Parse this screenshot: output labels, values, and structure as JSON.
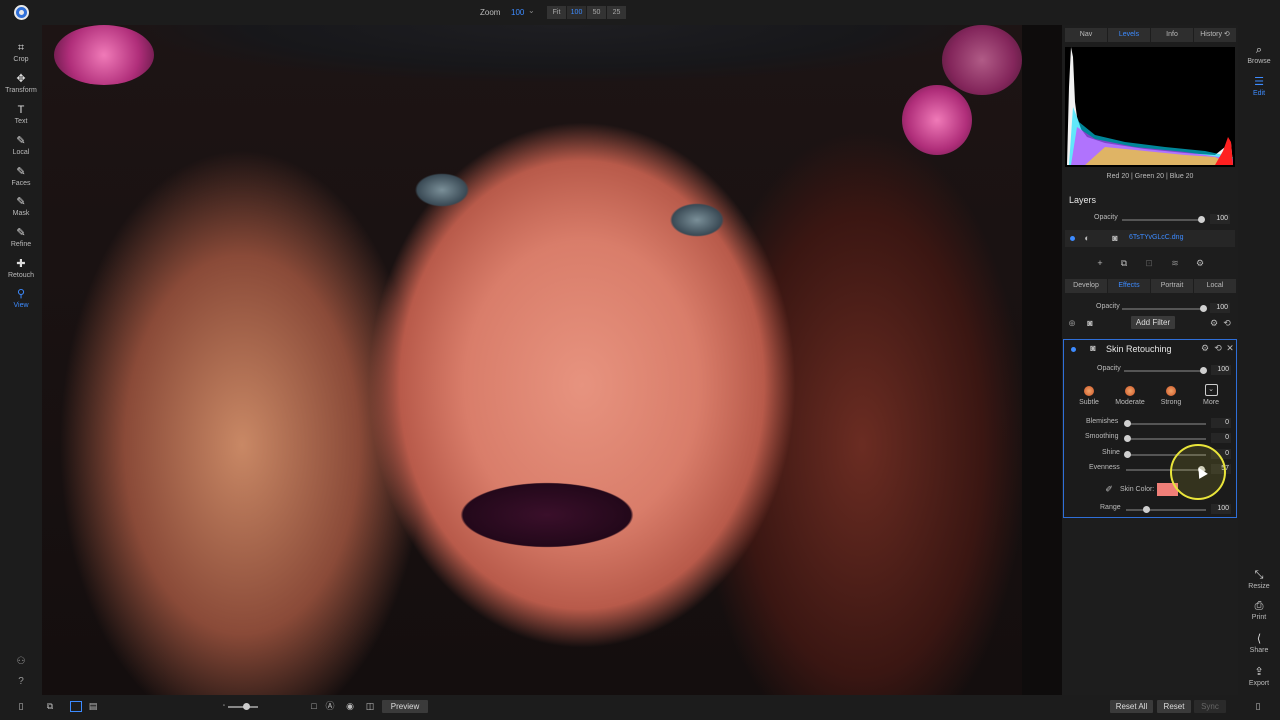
{
  "topbar": {
    "zoom_label": "Zoom",
    "zoom_value": "100",
    "zoom_caret": "⌄",
    "zoom_buttons": [
      "Fit",
      "100",
      "50",
      "25"
    ],
    "zoom_active": "100"
  },
  "left_tools": [
    {
      "label": "Crop",
      "icon": "crop-icon",
      "glyph": "⌗"
    },
    {
      "label": "Transform",
      "icon": "transform-icon",
      "glyph": "✥"
    },
    {
      "label": "Text",
      "icon": "text-icon",
      "glyph": "T"
    },
    {
      "label": "Local",
      "icon": "local-brush-icon",
      "glyph": "✎"
    },
    {
      "label": "Faces",
      "icon": "faces-icon",
      "glyph": "✎"
    },
    {
      "label": "Mask",
      "icon": "mask-icon",
      "glyph": "✎"
    },
    {
      "label": "Refine",
      "icon": "refine-icon",
      "glyph": "✎"
    },
    {
      "label": "Retouch",
      "icon": "retouch-icon",
      "glyph": "✚"
    },
    {
      "label": "View",
      "icon": "view-icon",
      "glyph": "⚲"
    }
  ],
  "active_tool": "View",
  "right_panel": {
    "nav_tabs": [
      "Nav",
      "Levels",
      "Info",
      "History ⟲"
    ],
    "nav_active": "Levels",
    "histogram_readout": "Red  20  | Green  20  | Blue  20",
    "layers_title": "Layers",
    "layers_opacity_label": "Opacity",
    "layers_opacity_value": "100",
    "layer_name": "6TsTYvGLcC.dng",
    "mode_tabs": [
      "Develop",
      "Effects",
      "Portrait",
      "Local"
    ],
    "mode_active": "Effects",
    "effects_opacity_label": "Opacity",
    "effects_opacity_value": "100",
    "add_filter_label": "Add Filter",
    "skin_retouching": {
      "title": "Skin Retouching",
      "opacity_label": "Opacity",
      "opacity_value": "100",
      "presets": [
        "Subtle",
        "Moderate",
        "Strong",
        "More"
      ],
      "sliders": [
        {
          "label": "Blemishes",
          "value": "0"
        },
        {
          "label": "Smoothing",
          "value": "0"
        },
        {
          "label": "Shine",
          "value": "0"
        },
        {
          "label": "Evenness",
          "value": "57"
        }
      ],
      "skin_color_label": "Skin Color:",
      "skin_color": "#f07f78",
      "range_label": "Range",
      "range_value": "100"
    }
  },
  "far_right": [
    {
      "label": "Browse",
      "icon": "browse-icon",
      "glyph": "⌕"
    },
    {
      "label": "Edit",
      "icon": "edit-sliders-icon",
      "glyph": "☰"
    },
    {
      "label": "Resize",
      "icon": "resize-icon",
      "glyph": "⤡"
    },
    {
      "label": "Print",
      "icon": "print-icon",
      "glyph": "⎙"
    },
    {
      "label": "Share",
      "icon": "share-icon",
      "glyph": "⟨"
    },
    {
      "label": "Export",
      "icon": "export-icon",
      "glyph": "⇪"
    }
  ],
  "far_right_active": "Edit",
  "bottombar": {
    "preview_label": "Preview",
    "reset_all_label": "Reset All",
    "reset_label": "Reset",
    "sync_label": "Sync"
  },
  "colors": {
    "accent": "#3d8bff",
    "panel_border": "#2f6fd8",
    "cursor_highlight": "#e9e53a"
  }
}
